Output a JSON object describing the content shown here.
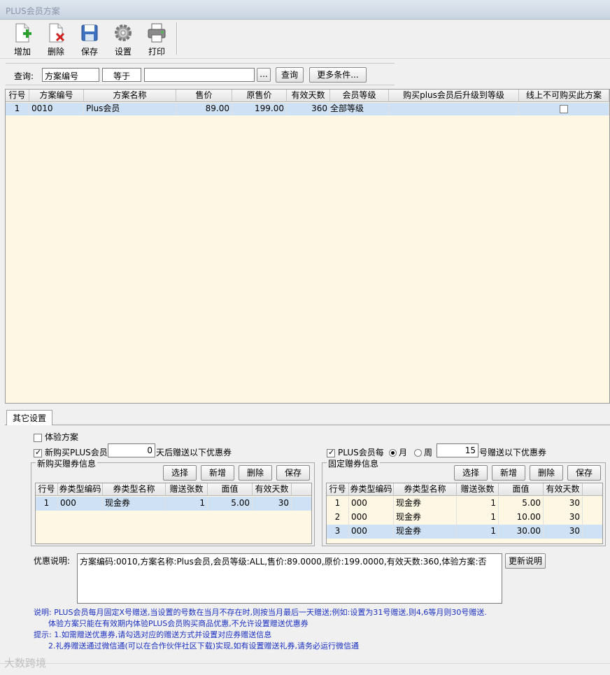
{
  "window": {
    "title": "PLUS会员方案"
  },
  "toolbar": {
    "add_label": "增加",
    "delete_label": "删除",
    "save_label": "保存",
    "settings_label": "设置",
    "print_label": "打印"
  },
  "query": {
    "label": "查询:",
    "field_value": "方案编号",
    "operator_value": "等于",
    "search_value": "",
    "ellipsis_label": "...",
    "search_button": "查询",
    "more_button": "更多条件..."
  },
  "main_table": {
    "headers": [
      "行号",
      "方案编号",
      "方案名称",
      "售价",
      "原售价",
      "有效天数",
      "会员等级",
      "购买plus会员后升级到等级",
      "线上不可购买此方案"
    ],
    "rows": [
      {
        "no": "1",
        "code": "0010",
        "name": "Plus会员",
        "price": "89.00",
        "orig_price": "199.00",
        "days": "360",
        "level": "全部等级",
        "upgrade": "",
        "offline_only": false
      }
    ]
  },
  "tabs": {
    "other_settings": "其它设置"
  },
  "settings": {
    "trial_label": "体验方案",
    "trial_checked": false,
    "new_buy_checked": true,
    "new_buy_label": "新购买PLUS会员",
    "new_buy_days": "0",
    "new_buy_suffix": "天后赠送以下优惠券",
    "monthly_checked": true,
    "monthly_label": "PLUS会员每",
    "month_label": "月",
    "week_label": "周",
    "period_selected": "月",
    "monthly_day": "15",
    "monthly_suffix": "号赠送以下优惠券"
  },
  "new_coupon_group": {
    "title": "新购买赠券信息",
    "select_button": "选择",
    "add_button": "新增",
    "delete_button": "删除",
    "save_button": "保存",
    "headers": [
      "行号",
      "券类型编码",
      "券类型名称",
      "赠送张数",
      "面值",
      "有效天数"
    ],
    "rows": [
      {
        "no": "1",
        "code": "000",
        "name": "现金券",
        "count": "1",
        "value": "5.00",
        "days": "30"
      }
    ]
  },
  "fixed_coupon_group": {
    "title": "固定赠券信息",
    "select_button": "选择",
    "add_button": "新增",
    "delete_button": "删除",
    "save_button": "保存",
    "headers": [
      "行号",
      "券类型编码",
      "券类型名称",
      "赠送张数",
      "面值",
      "有效天数"
    ],
    "rows": [
      {
        "no": "1",
        "code": "000",
        "name": "现金券",
        "count": "1",
        "value": "5.00",
        "days": "30"
      },
      {
        "no": "2",
        "code": "000",
        "name": "现金券",
        "count": "1",
        "value": "10.00",
        "days": "30"
      },
      {
        "no": "3",
        "code": "000",
        "name": "现金券",
        "count": "1",
        "value": "30.00",
        "days": "30"
      }
    ]
  },
  "description": {
    "label": "优惠说明:",
    "text": "方案编码:0010,方案名称:Plus会员,会员等级:ALL,售价:89.0000,原价:199.0000,有效天数:360,体验方案:否",
    "update_button": "更新说明"
  },
  "notes": {
    "line1": "说明: PLUS会员每月固定X号赠送,当设置的号数在当月不存在时,则按当月最后一天赠送;例如:设置为31号赠送,则4,6等月则30号赠送.",
    "line2": "      体验方案只能在有效期内体验PLUS会员购买商品优惠,不允许设置赠送优惠券",
    "line3": "提示: 1.如需赠送优惠券,请勾选对应的赠送方式并设置对应券赠送信息",
    "line4": "      2.礼券赠送通过微信通(可以在合作伙伴社区下载)实现,如有设置赠送礼券,请务必运行微信通"
  },
  "watermark": "大数跨境"
}
